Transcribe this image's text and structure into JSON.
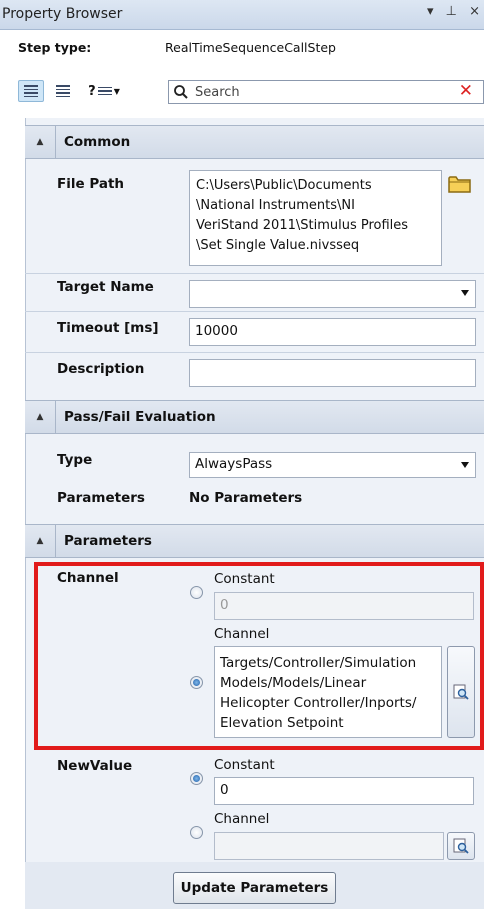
{
  "window": {
    "title": "Property Browser",
    "controls": "▾ ⊥ ×"
  },
  "step": {
    "type_label": "Step type:",
    "type_value": "RealTimeSequenceCallStep"
  },
  "toolbar": {
    "help_glyph": "?"
  },
  "search": {
    "placeholder": "Search",
    "clear_glyph": "✕"
  },
  "sections": {
    "common": {
      "title": "Common",
      "file_path_label": "File Path",
      "file_path_value": [
        "C:\\Users\\Public\\Documents",
        "\\National Instruments\\NI",
        "VeriStand 2011\\Stimulus Profiles",
        "\\Set Single Value.nivsseq"
      ],
      "target_name_label": "Target Name",
      "target_name_value": "",
      "timeout_label": "Timeout [ms]",
      "timeout_value": "10000",
      "description_label": "Description",
      "description_value": ""
    },
    "passfail": {
      "title": "Pass/Fail Evaluation",
      "type_label": "Type",
      "type_value": "AlwaysPass",
      "parameters_label": "Parameters",
      "parameters_value": "No Parameters"
    },
    "parameters": {
      "title": "Parameters",
      "channel_label": "Channel",
      "channel_constant_label": "Constant",
      "channel_constant_value": "0",
      "channel_channel_label": "Channel",
      "channel_channel_value": [
        "Targets/Controller/Simulation",
        "Models/Models/Linear",
        "Helicopter Controller/Inports/",
        "Elevation Setpoint"
      ],
      "newvalue_label": "NewValue",
      "newvalue_constant_label": "Constant",
      "newvalue_constant_value": "0",
      "newvalue_channel_label": "Channel",
      "newvalue_channel_value": "",
      "update_button": "Update Parameters"
    }
  },
  "colors": {
    "highlight": "#e11b1b",
    "panel_bg": "#eef2f8",
    "header_bg": "#d2dbe8"
  }
}
